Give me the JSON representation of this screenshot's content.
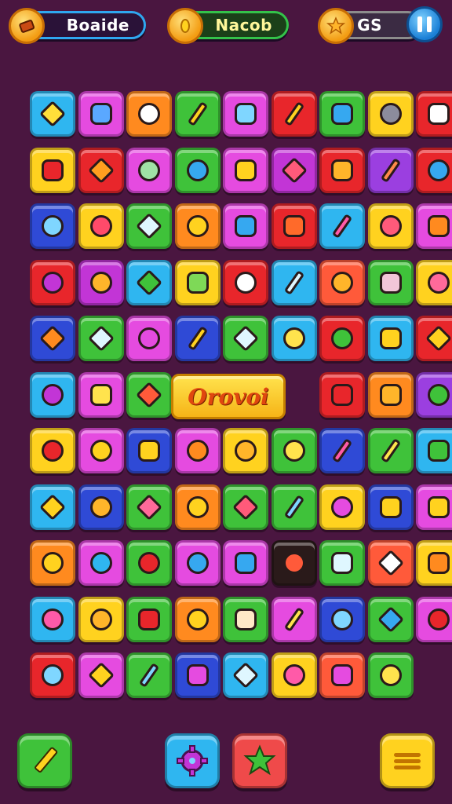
{
  "header": {
    "left_label": "Boaide",
    "center_label": "Nacob",
    "right_label": "GS"
  },
  "board": {
    "special_word": "Orovoi",
    "tiles": [
      {
        "c": "#2fb6f0",
        "i": "#ffdf3a",
        "s": "diamond",
        "n": "leaf-icon"
      },
      {
        "c": "#e54be0",
        "i": "#5aa8ff",
        "s": "sq",
        "n": "phone-icon"
      },
      {
        "c": "#ff8a1f",
        "i": "#ffffff",
        "s": "round",
        "n": "target-icon"
      },
      {
        "c": "#3fc23a",
        "i": "#ffd21f",
        "s": "stick",
        "n": "pencil-icon"
      },
      {
        "c": "#e54be0",
        "i": "#7fd6ff",
        "s": "sq",
        "n": "tag-icon"
      },
      {
        "c": "#e8262b",
        "i": "#ffd21f",
        "s": "stick",
        "n": "pencil-icon"
      },
      {
        "c": "#3fc23a",
        "i": "#36a8f0",
        "s": "sq",
        "n": "cube-icon"
      },
      {
        "c": "#ffd21f",
        "i": "#8c8c9c",
        "s": "round",
        "n": "face-icon"
      },
      {
        "c": "#e8262b",
        "i": "#ffffff",
        "s": "sq",
        "n": "chart-icon"
      },
      {
        "c": "#ffd21f",
        "i": "#e8262b",
        "s": "sq",
        "n": "frame-icon"
      },
      {
        "c": "#e8262b",
        "i": "#ff9f1f",
        "s": "diamond",
        "n": "cheese-icon"
      },
      {
        "c": "#e54be0",
        "i": "#9fe3a5",
        "s": "round",
        "n": "alien-icon"
      },
      {
        "c": "#3fc23a",
        "i": "#36a8f0",
        "s": "round",
        "n": "gear-icon"
      },
      {
        "c": "#e54be0",
        "i": "#ffd21f",
        "s": "sq",
        "n": "monster-icon"
      },
      {
        "c": "#c235d6",
        "i": "#ff5a7a",
        "s": "diamond",
        "n": "heart-icon"
      },
      {
        "c": "#e8262b",
        "i": "#ffb52a",
        "s": "sq",
        "n": "jar-icon"
      },
      {
        "c": "#9b3fe0",
        "i": "#ff8a4a",
        "s": "stick",
        "n": "crayon-icon"
      },
      {
        "c": "#e8262b",
        "i": "#36a8f0",
        "s": "round",
        "n": "apple-icon"
      },
      {
        "c": "#2f4ad6",
        "i": "#7fd6ff",
        "s": "round",
        "n": "ring-icon"
      },
      {
        "c": "#ffd21f",
        "i": "#ff4a6a",
        "s": "round",
        "n": "gem-icon"
      },
      {
        "c": "#3fc23a",
        "i": "#dff7ff",
        "s": "diamond",
        "n": "eraser-icon"
      },
      {
        "c": "#ff8a1f",
        "i": "#ffd21f",
        "s": "round",
        "n": "smile-icon"
      },
      {
        "c": "#e54be0",
        "i": "#36a8f0",
        "s": "sq",
        "n": "ticket-icon"
      },
      {
        "c": "#e8262b",
        "i": "#ff6a2a",
        "s": "sq",
        "n": "box-icon"
      },
      {
        "c": "#2fb6f0",
        "i": "#ff5aa8",
        "s": "stick",
        "n": "marker-icon"
      },
      {
        "c": "#ffd21f",
        "i": "#ff5a7a",
        "s": "round",
        "n": "pig-icon"
      },
      {
        "c": "#e54be0",
        "i": "#ff8a1f",
        "s": "sq",
        "n": "lantern-icon"
      },
      {
        "c": "#e8262b",
        "i": "#c235d6",
        "s": "round",
        "n": "balloon-icon"
      },
      {
        "c": "#c235d6",
        "i": "#ffb52a",
        "s": "round",
        "n": "flower-icon"
      },
      {
        "c": "#2fb6f0",
        "i": "#3fc23a",
        "s": "diamond",
        "n": "leaf-icon"
      },
      {
        "c": "#ffd21f",
        "i": "#7ed957",
        "s": "sq",
        "n": "battery-icon"
      },
      {
        "c": "#e8262b",
        "i": "#ffffff",
        "s": "round",
        "n": "star-icon"
      },
      {
        "c": "#2fb6f0",
        "i": "#dff7ff",
        "s": "stick",
        "n": "pen-icon"
      },
      {
        "c": "#ff5a3a",
        "i": "#ffb52a",
        "s": "round",
        "n": "spiral-icon"
      },
      {
        "c": "#3fc23a",
        "i": "#f2c6d8",
        "s": "sq",
        "n": "bucket-icon"
      },
      {
        "c": "#ffd21f",
        "i": "#ff6a9a",
        "s": "round",
        "n": "bear-icon"
      },
      {
        "c": "#2f4ad6",
        "i": "#ff8a1f",
        "s": "diamond",
        "n": "carrot-icon"
      },
      {
        "c": "#3fc23a",
        "i": "#dff7ff",
        "s": "diamond",
        "n": "fish-icon"
      },
      {
        "c": "#e54be0",
        "i": "#e54be0",
        "s": "round",
        "n": "splat-icon"
      },
      {
        "c": "#2f4ad6",
        "i": "#ffd21f",
        "s": "stick",
        "n": "hammer-icon"
      },
      {
        "c": "#3fc23a",
        "i": "#dff7ff",
        "s": "diamond",
        "n": "shard-icon"
      },
      {
        "c": "#2fb6f0",
        "i": "#ffe34d",
        "s": "round",
        "n": "lemon-icon"
      },
      {
        "c": "#e8262b",
        "i": "#3fc23a",
        "s": "round",
        "n": "balloon-icon"
      },
      {
        "c": "#2fb6f0",
        "i": "#ffd21f",
        "s": "sq",
        "n": "jar-icon"
      },
      {
        "c": "#e8262b",
        "i": "#ffd21f",
        "s": "diamond",
        "n": "leaf-icon"
      },
      {
        "c": "#2fb6f0",
        "i": "#c235d6",
        "s": "round",
        "n": "splat-icon"
      },
      {
        "c": "#e54be0",
        "i": "#ffe34d",
        "s": "sq",
        "n": "clipboard-icon"
      },
      {
        "c": "#3fc23a",
        "i": "#ff5a3a",
        "s": "diamond",
        "n": "feather-icon"
      },
      {
        "c": "#e8262b",
        "i": "#e8262b",
        "s": "sq",
        "n": "bag-icon"
      },
      {
        "c": "#ff8a1f",
        "i": "#ffb52a",
        "s": "sq",
        "n": "gift-icon"
      },
      {
        "c": "#9b3fe0",
        "i": "#3fc23a",
        "s": "round",
        "n": "magnifier-icon"
      },
      {
        "c": "#ffd21f",
        "i": "#e8262b",
        "s": "round",
        "n": "apple-icon"
      },
      {
        "c": "#e54be0",
        "i": "#ffd21f",
        "s": "round",
        "n": "sun-icon"
      },
      {
        "c": "#2f4ad6",
        "i": "#ffd21f",
        "s": "sq",
        "n": "cube-icon"
      },
      {
        "c": "#e54be0",
        "i": "#ff8a1f",
        "s": "round",
        "n": "shell-icon"
      },
      {
        "c": "#ffd21f",
        "i": "#ffb52a",
        "s": "round",
        "n": "cat-icon"
      },
      {
        "c": "#3fc23a",
        "i": "#ffe34d",
        "s": "round",
        "n": "balloon-icon"
      },
      {
        "c": "#2f4ad6",
        "i": "#ff5aa8",
        "s": "stick",
        "n": "crayon-icon"
      },
      {
        "c": "#3fc23a",
        "i": "#ffe34d",
        "s": "stick",
        "n": "pencil-icon"
      },
      {
        "c": "#2fb6f0",
        "i": "#3fc23a",
        "s": "sq",
        "n": "basket-icon"
      },
      {
        "c": "#2fb6f0",
        "i": "#ffd21f",
        "s": "diamond",
        "n": "bow-icon"
      },
      {
        "c": "#2f4ad6",
        "i": "#ffb52a",
        "s": "round",
        "n": "gear-icon"
      },
      {
        "c": "#3fc23a",
        "i": "#ff6a9a",
        "s": "diamond",
        "n": "heart-icon"
      },
      {
        "c": "#ff8a1f",
        "i": "#ffd21f",
        "s": "round",
        "n": "smile-icon"
      },
      {
        "c": "#3fc23a",
        "i": "#ff5a7a",
        "s": "diamond",
        "n": "gem-icon"
      },
      {
        "c": "#3fc23a",
        "i": "#7fd6ff",
        "s": "stick",
        "n": "marker-icon"
      },
      {
        "c": "#ffd21f",
        "i": "#e54be0",
        "s": "round",
        "n": "lollipop-icon"
      },
      {
        "c": "#2f4ad6",
        "i": "#ffd21f",
        "s": "sq",
        "n": "bottle-icon"
      },
      {
        "c": "#e54be0",
        "i": "#ffd21f",
        "s": "sq",
        "n": "cloud-icon"
      },
      {
        "c": "#ff8a1f",
        "i": "#ffd21f",
        "s": "round",
        "n": "bulb-icon"
      },
      {
        "c": "#e54be0",
        "i": "#2fb6f0",
        "s": "round",
        "n": "ring-icon"
      },
      {
        "c": "#3fc23a",
        "i": "#e8262b",
        "s": "round",
        "n": "cherry-icon"
      },
      {
        "c": "#e54be0",
        "i": "#36a8f0",
        "s": "round",
        "n": "splash-icon"
      },
      {
        "c": "#e54be0",
        "i": "#36a8f0",
        "s": "sq",
        "n": "tag-icon"
      },
      {
        "c": "#2a1a1a",
        "i": "#ff5a3a",
        "s": "round",
        "n": "firework-icon"
      },
      {
        "c": "#3fc23a",
        "i": "#dff7ff",
        "s": "sq",
        "n": "bucket-icon"
      },
      {
        "c": "#ff5a3a",
        "i": "#ffffff",
        "s": "diamond",
        "n": "chair-icon"
      },
      {
        "c": "#ffd21f",
        "i": "#ff8a1f",
        "s": "sq",
        "n": "gift-icon"
      },
      {
        "c": "#2fb6f0",
        "i": "#ff5aa8",
        "s": "round",
        "n": "balloon-icon"
      },
      {
        "c": "#ffd21f",
        "i": "#ffb52a",
        "s": "round",
        "n": "egg-icon"
      },
      {
        "c": "#3fc23a",
        "i": "#e8262b",
        "s": "sq",
        "n": "box-icon"
      },
      {
        "c": "#ff8a1f",
        "i": "#ffd21f",
        "s": "round",
        "n": "bear-icon"
      },
      {
        "c": "#3fc23a",
        "i": "#ffe9c7",
        "s": "sq",
        "n": "clipboard-icon"
      },
      {
        "c": "#e54be0",
        "i": "#ffe34d",
        "s": "stick",
        "n": "pencil-icon"
      },
      {
        "c": "#2f4ad6",
        "i": "#7fd6ff",
        "s": "round",
        "n": "ghost-icon"
      },
      {
        "c": "#3fc23a",
        "i": "#36a8f0",
        "s": "diamond",
        "n": "feather-icon"
      },
      {
        "c": "#e54be0",
        "i": "#e8262b",
        "s": "round",
        "n": "apple-icon"
      },
      {
        "c": "#e8262b",
        "i": "#7fd6ff",
        "s": "round",
        "n": "wheel-icon"
      },
      {
        "c": "#e54be0",
        "i": "#ffd21f",
        "s": "diamond",
        "n": "leaf-icon"
      },
      {
        "c": "#3fc23a",
        "i": "#7fd6ff",
        "s": "stick",
        "n": "pencil-icon"
      },
      {
        "c": "#2f4ad6",
        "i": "#e54be0",
        "s": "sq",
        "n": "note-icon"
      },
      {
        "c": "#2fb6f0",
        "i": "#dff7ff",
        "s": "diamond",
        "n": "gem-icon"
      },
      {
        "c": "#ffd21f",
        "i": "#ff5aa8",
        "s": "round",
        "n": "balloon-icon"
      },
      {
        "c": "#ff5a3a",
        "i": "#e54be0",
        "s": "sq",
        "n": "book-icon"
      },
      {
        "c": "#3fc23a",
        "i": "#ffe34d",
        "s": "round",
        "n": "lemon-icon"
      }
    ]
  },
  "bottom": {
    "pencil_icon": "pencil-icon",
    "gear_icon": "gear-icon",
    "star_icon": "star-icon",
    "menu_icon": "menu-icon"
  }
}
